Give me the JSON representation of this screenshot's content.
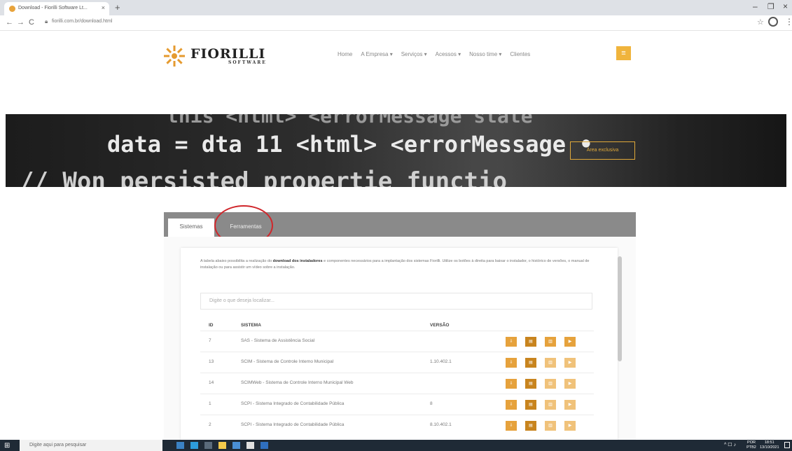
{
  "browser": {
    "tab_title": "Download - Fiorilli Software Lt...",
    "tab_close": "×",
    "new_tab": "+",
    "url": "fiorilli.com.br/download.html",
    "window_min": "–",
    "window_max": "❐",
    "window_close": "×",
    "back": "←",
    "forward": "→",
    "reload": "C",
    "star": "☆",
    "menu_dots": "⋮"
  },
  "site": {
    "logo_text": "FIORILLI",
    "logo_sub": "SOFTWARE",
    "nav": [
      "Home",
      "A Empresa ▾",
      "Serviços ▾",
      "Acessos ▾",
      "Nosso time ▾",
      "Clientes"
    ],
    "menu_icon": "≡"
  },
  "hero": {
    "line1": "this <html> <errorMessage state",
    "line2": "data = dta  11  <html> <errorMessage • ",
    "line3": "// Won   persisted propertie functio",
    "button": "Área exclusiva"
  },
  "tabs": {
    "sistemas": "Sistemas",
    "ferramentas": "Ferramentas"
  },
  "content": {
    "desc_prefix": "A tabela abaixo possibilita a realização do ",
    "desc_bold": "download dos instaladores",
    "desc_suffix": " e componentes necessários para a implantação dos sistemas Fiorilli. Utilize os botões à direita para baixar o instalador, o histórico de versões, o manual de instalação ou para assistir um vídeo sobre a instalação.",
    "search_placeholder": "Digite o que deseja localizar...",
    "headers": {
      "id": "ID",
      "sistema": "SISTEMA",
      "versao": "VERSÃO"
    },
    "rows": [
      {
        "id": "7",
        "sistema": "SAS - Sistema de Assistência Social",
        "versao": ""
      },
      {
        "id": "13",
        "sistema": "SCIM - Sistema de Controle Interno Municipal",
        "versao": "1.10.402.1"
      },
      {
        "id": "14",
        "sistema": "SCIMWeb - Sistema de Controle Interno Municipal Web",
        "versao": ""
      },
      {
        "id": "1",
        "sistema": "SCPI - Sistema Integrado de Contabilidade Pública",
        "versao": "8"
      },
      {
        "id": "2",
        "sistema": "SCPI - Sistema Integrado de Contabilidade Pública",
        "versao": "8.10.402.1"
      }
    ],
    "action_icons": [
      "download-icon",
      "history-icon",
      "manual-icon",
      "video-icon"
    ]
  },
  "taskbar": {
    "start": "⊞",
    "search_placeholder": "Digite aqui para pesquisar",
    "tray": "^ ☐ ♪",
    "lang": "POR PTB2",
    "time": "18:51",
    "date": "13/10/2021"
  }
}
